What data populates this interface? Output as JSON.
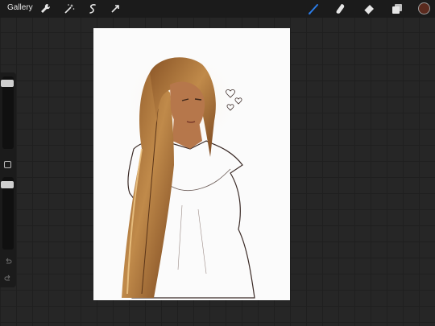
{
  "topbar": {
    "gallery_label": "Gallery",
    "left_tools": [
      "wrench-icon",
      "magic-wand-icon",
      "selection-icon",
      "transform-icon"
    ],
    "right_tools": [
      "brush-icon",
      "smudge-icon",
      "eraser-icon",
      "layers-icon"
    ],
    "active_tool": "brush-icon",
    "active_color": "#5a2a1e",
    "accent_color": "#2b7de9"
  },
  "sidebar": {
    "controls": [
      "brush-size-slider",
      "modify-button",
      "opacity-slider",
      "undo-icon",
      "redo-icon"
    ]
  }
}
